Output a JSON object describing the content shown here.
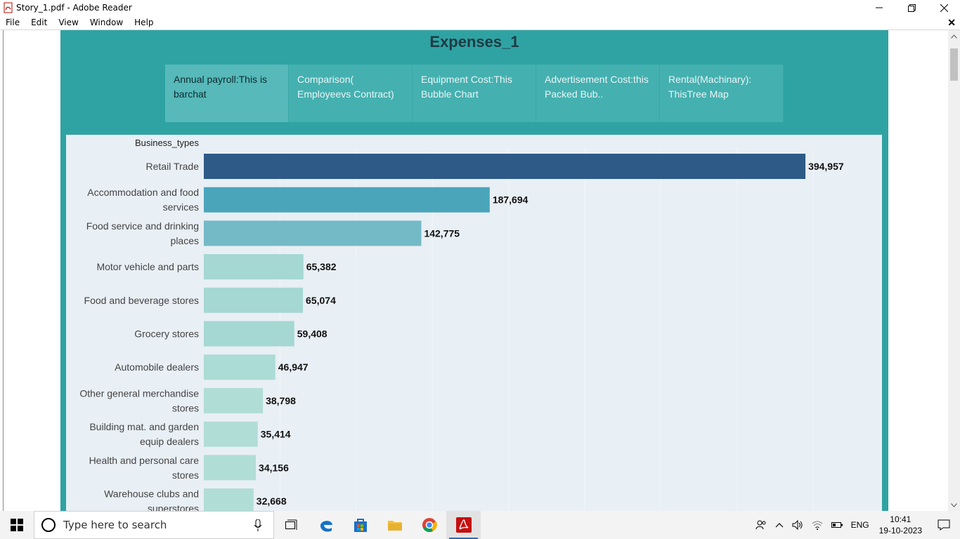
{
  "window": {
    "title": "Story_1.pdf - Adobe Reader"
  },
  "menu": [
    "File",
    "Edit",
    "View",
    "Window",
    "Help"
  ],
  "story": {
    "title": "Expenses_1",
    "tabs": [
      "Annual payroll:This is barchat",
      "Comparison( Employeevs Contract)",
      "Equipment Cost:This Bubble Chart",
      "Advertisement Cost:this Packed Bub..",
      "Rental(Machinary): ThisTree Map"
    ]
  },
  "chart_data": {
    "type": "bar",
    "orientation": "horizontal",
    "ylabel": "Business_types",
    "categories": [
      "Retail Trade",
      "Accommodation and food services",
      "Food service and drinking places",
      "Motor vehicle and parts",
      "Food and beverage stores",
      "Grocery stores",
      "Automobile dealers",
      "Other general merchandise stores",
      "Building mat. and garden equip dealers",
      "Health and personal care stores",
      "Warehouse clubs and superstores"
    ],
    "category_lines": [
      [
        "Retail Trade"
      ],
      [
        "Accommodation and food",
        "services"
      ],
      [
        "Food service and drinking",
        "places"
      ],
      [
        "Motor vehicle and parts"
      ],
      [
        "Food and beverage stores"
      ],
      [
        "Grocery stores"
      ],
      [
        "Automobile dealers"
      ],
      [
        "Other general merchandise",
        "stores"
      ],
      [
        "Building mat. and garden",
        "equip dealers"
      ],
      [
        "Health and personal care",
        "stores"
      ],
      [
        "Warehouse clubs and",
        "superstores"
      ]
    ],
    "values": [
      394957,
      187694,
      142775,
      65382,
      65074,
      59408,
      46947,
      38798,
      35414,
      34156,
      32668
    ],
    "labels": [
      "394,957",
      "187,694",
      "142,775",
      "65,382",
      "65,074",
      "59,408",
      "46,947",
      "38,798",
      "35,414",
      "34,156",
      "32,668"
    ],
    "xlim": [
      0,
      400000
    ],
    "grid": true,
    "colors": [
      "#2d5a87",
      "#4aa5bb",
      "#74b9c6",
      "#a5d7d3",
      "#a5d7d3",
      "#a5d7d3",
      "#acdcd6",
      "#b1ddd7",
      "#b1ddd7",
      "#b1ddd7",
      "#b1ddd7"
    ]
  },
  "taskbar": {
    "search_placeholder": "Type here to search",
    "language": "ENG",
    "time": "10:41",
    "date": "19-10-2023"
  }
}
